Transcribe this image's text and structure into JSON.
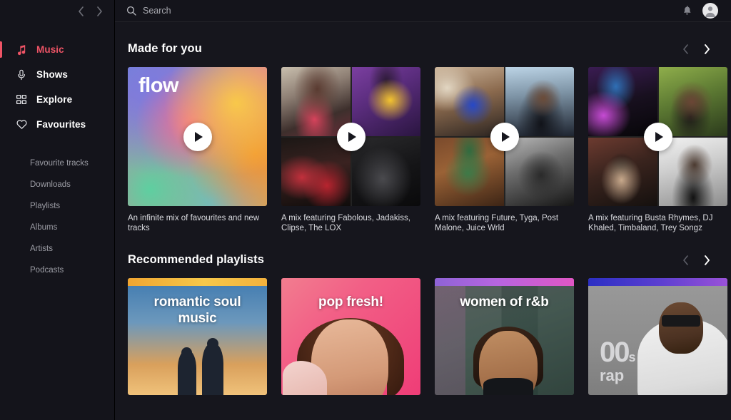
{
  "sidebar": {
    "back_arrow": "back-arrow",
    "forward_arrow": "forward-arrow",
    "nav": [
      {
        "label": "Music",
        "icon": "music-note-icon",
        "active": true
      },
      {
        "label": "Shows",
        "icon": "microphone-icon",
        "active": false
      },
      {
        "label": "Explore",
        "icon": "grid-icon",
        "active": false
      },
      {
        "label": "Favourites",
        "icon": "heart-icon",
        "active": false
      }
    ],
    "sub_items": [
      {
        "label": "Favourite tracks"
      },
      {
        "label": "Downloads"
      },
      {
        "label": "Playlists"
      },
      {
        "label": "Albums"
      },
      {
        "label": "Artists"
      },
      {
        "label": "Podcasts"
      }
    ]
  },
  "topbar": {
    "search_placeholder": "Search",
    "search_value": "",
    "search_icon": "search-icon",
    "notifications_icon": "bell-icon",
    "avatar_icon": "user-avatar-icon"
  },
  "sections": [
    {
      "title": "Made for you",
      "prev_label": "‹",
      "next_label": "›",
      "cards": [
        {
          "overlay_title": "flow",
          "desc": "An infinite mix of favourites and new tracks",
          "play_label": "play"
        },
        {
          "overlay_title": "",
          "desc": "A mix featuring Fabolous, Jadakiss, Clipse, The LOX",
          "play_label": "play"
        },
        {
          "overlay_title": "",
          "desc": "A mix featuring Future, Tyga, Post Malone, Juice Wrld",
          "play_label": "play"
        },
        {
          "overlay_title": "",
          "desc": "A mix featuring Busta Rhymes, DJ Khaled, Timbaland, Trey Songz",
          "play_label": "play"
        }
      ]
    },
    {
      "title": "Recommended playlists",
      "prev_label": "‹",
      "next_label": "›",
      "cards": [
        {
          "overlay_title": "romantic soul music"
        },
        {
          "overlay_title": "pop fresh!"
        },
        {
          "overlay_title": "women of r&b"
        },
        {
          "overlay_title_line1": "00",
          "overlay_title_sup": "s",
          "overlay_title_line2": "rap"
        }
      ]
    }
  ],
  "colors": {
    "accent": "#ef5466",
    "sidebar_bg": "#14141b",
    "main_bg": "#16161d",
    "text_primary": "#ffffff",
    "text_secondary": "#9b9ca4"
  }
}
